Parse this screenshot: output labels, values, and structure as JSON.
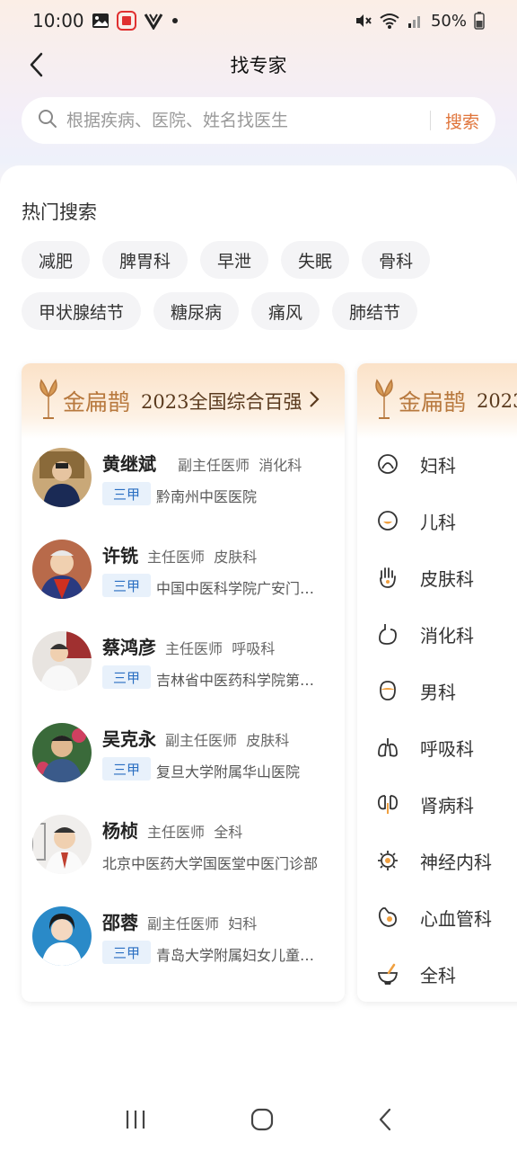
{
  "status": {
    "time": "10:00",
    "battery": "50%"
  },
  "header": {
    "title": "找专家"
  },
  "search": {
    "placeholder": "根据疾病、医院、姓名找医生",
    "button": "搜索"
  },
  "hot": {
    "title": "热门搜索",
    "tags_row1": [
      "减肥",
      "脾胃科",
      "早泄",
      "失眠",
      "骨科"
    ],
    "tags_row2": [
      "甲状腺结节",
      "糖尿病",
      "痛风",
      "肺结节"
    ]
  },
  "card1": {
    "logo": "金扁鹊",
    "subtitle": "2023全国综合百强",
    "doctors": [
      {
        "name": "黄继斌",
        "title": "副主任医师",
        "dept": "消化科",
        "badge": "三甲",
        "hospital": "黔南州中医医院"
      },
      {
        "name": "许铣",
        "title": "主任医师",
        "dept": "皮肤科",
        "badge": "三甲",
        "hospital": "中国中医科学院广安门医院"
      },
      {
        "name": "蔡鸿彦",
        "title": "主任医师",
        "dept": "呼吸科",
        "badge": "三甲",
        "hospital": "吉林省中医药科学院第一临床医院"
      },
      {
        "name": "吴克永",
        "title": "副主任医师",
        "dept": "皮肤科",
        "badge": "三甲",
        "hospital": "复旦大学附属华山医院"
      },
      {
        "name": "杨桢",
        "title": "主任医师",
        "dept": "全科",
        "badge": "",
        "hospital": "北京中医药大学国医堂中医门诊部"
      },
      {
        "name": "邵蓉",
        "title": "副主任医师",
        "dept": "妇科",
        "badge": "三甲",
        "hospital": "青岛大学附属妇女儿童医院"
      }
    ]
  },
  "card2": {
    "logo": "金扁鹊",
    "subtitle": "2023",
    "departments": [
      "妇科",
      "儿科",
      "皮肤科",
      "消化科",
      "男科",
      "呼吸科",
      "肾病科",
      "神经内科",
      "心血管科",
      "全科"
    ]
  },
  "colors": {
    "accent": "#e0743a",
    "gold": "#b8793e",
    "badge_bg": "#e8f1fb",
    "badge_text": "#2a6fc2"
  }
}
